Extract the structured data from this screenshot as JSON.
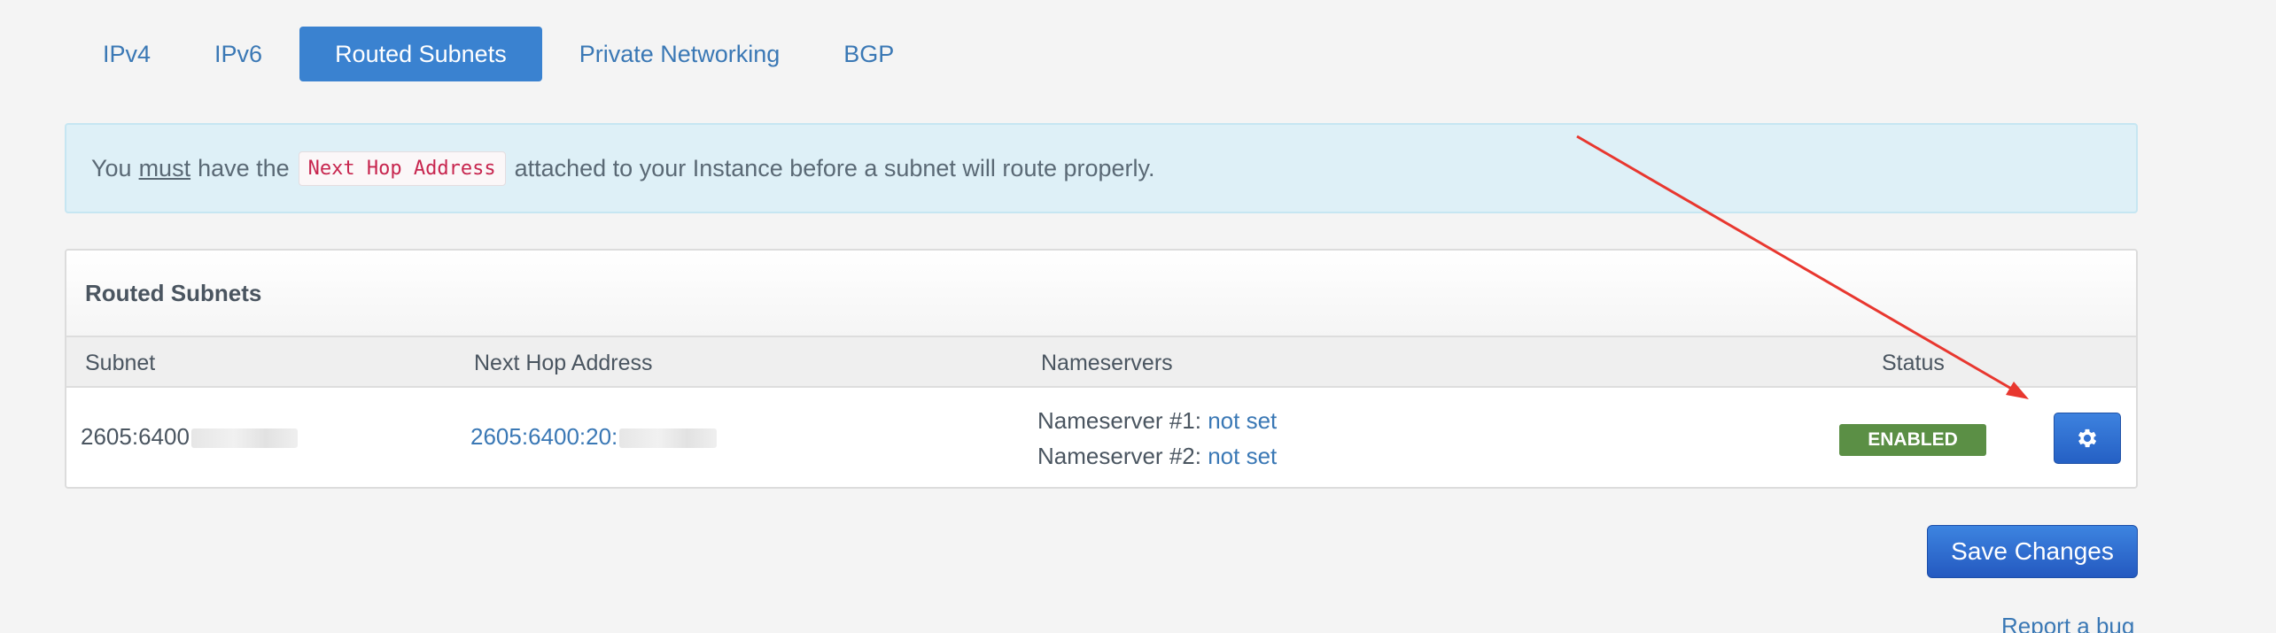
{
  "tabs": [
    {
      "label": "IPv4"
    },
    {
      "label": "IPv6"
    },
    {
      "label": "Routed Subnets",
      "active": true
    },
    {
      "label": "Private Networking"
    },
    {
      "label": "BGP"
    }
  ],
  "alert": {
    "prefix": "You",
    "emphasis": "must",
    "middle": "have the",
    "code": "Next Hop Address",
    "suffix": "attached to your Instance before a subnet will route properly."
  },
  "panel": {
    "title": "Routed Subnets",
    "columns": {
      "subnet": "Subnet",
      "next_hop": "Next Hop Address",
      "nameservers": "Nameservers",
      "status": "Status"
    },
    "row": {
      "subnet": "2605:6400",
      "next_hop": "2605:6400:20:",
      "ns1_label": "Nameserver #1:",
      "ns1_value": "not set",
      "ns2_label": "Nameserver #2:",
      "ns2_value": "not set",
      "status": "ENABLED",
      "settings_icon": "gear-icon"
    }
  },
  "save_label": "Save Changes",
  "report_label": "Report a bug",
  "colors": {
    "accent": "#3a82d0",
    "alert_bg": "#def0f7",
    "status_enabled": "#5b8f45",
    "annotation_arrow": "#e8372f"
  }
}
